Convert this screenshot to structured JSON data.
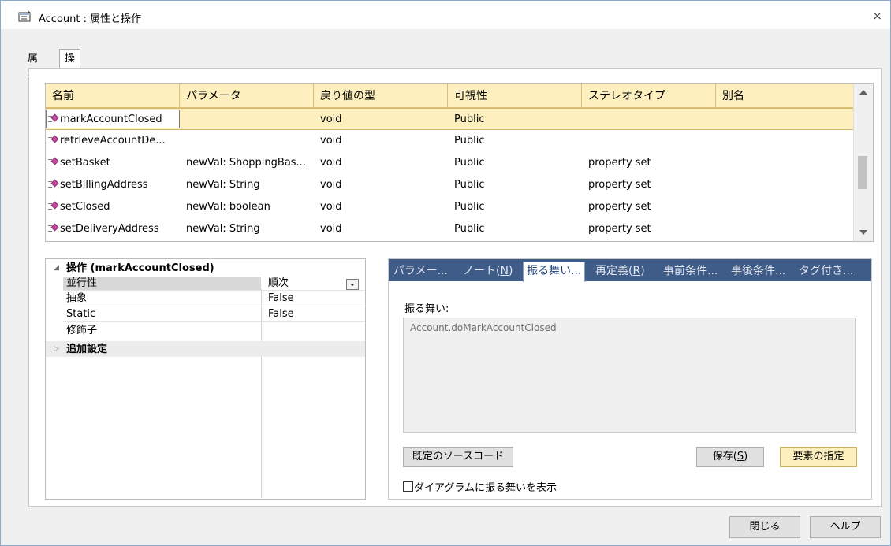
{
  "window": {
    "title": "Account : 属性と操作",
    "close_glyph": "×"
  },
  "tabs": [
    {
      "label": "属性",
      "active": false
    },
    {
      "label": "操作",
      "active": true
    }
  ],
  "grid": {
    "columns": [
      "名前",
      "パラメータ",
      "戻り値の型",
      "可視性",
      "ステレオタイプ",
      "別名"
    ],
    "rows": [
      {
        "name": "markAccountClosed",
        "params": "",
        "return_type": "void",
        "visibility": "Public",
        "stereotype": "",
        "alias": "",
        "selected": true
      },
      {
        "name": "retrieveAccountDe...",
        "params": "",
        "return_type": "void",
        "visibility": "Public",
        "stereotype": "",
        "alias": ""
      },
      {
        "name": "setBasket",
        "params": "newVal: ShoppingBas...",
        "return_type": "void",
        "visibility": "Public",
        "stereotype": "property set",
        "alias": ""
      },
      {
        "name": "setBillingAddress",
        "params": "newVal: String",
        "return_type": "void",
        "visibility": "Public",
        "stereotype": "property set",
        "alias": ""
      },
      {
        "name": "setClosed",
        "params": "newVal: boolean",
        "return_type": "void",
        "visibility": "Public",
        "stereotype": "property set",
        "alias": ""
      },
      {
        "name": "setDeliveryAddress",
        "params": "newVal: String",
        "return_type": "void",
        "visibility": "Public",
        "stereotype": "property set",
        "alias": ""
      }
    ]
  },
  "properties": {
    "section_title": "操作 (markAccountClosed)",
    "expand_glyph": "◢",
    "collapse_glyph": "▷",
    "items": [
      {
        "label": "並行性",
        "value": "順次"
      },
      {
        "label": "抽象",
        "value": "False"
      },
      {
        "label": "Static",
        "value": "False"
      },
      {
        "label": "修飾子",
        "value": ""
      }
    ],
    "advanced_title": "追加設定"
  },
  "detail": {
    "tabs": [
      {
        "label": "パラメー..."
      },
      {
        "label": "ノート(",
        "mnemonic": "N",
        "suffix": ")"
      },
      {
        "label": "振る舞い...",
        "active": true
      },
      {
        "label": "再定義(",
        "mnemonic": "R",
        "suffix": ")"
      },
      {
        "label": "事前条件..."
      },
      {
        "label": "事後条件..."
      },
      {
        "label": "タグ付き..."
      }
    ],
    "behavior_label": "振る舞い:",
    "behavior_text": "Account.doMarkAccountClosed",
    "default_source_button": "既定のソースコード",
    "save_button": {
      "label": "保存(",
      "mnemonic": "S",
      "suffix": ")"
    },
    "assign_element_button": "要素の指定",
    "show_in_diagram_checkbox": "ダイアグラムに振る舞いを表示",
    "show_in_diagram_checked": false
  },
  "footer": {
    "close_button": "閉じる",
    "help_button": "ヘルプ"
  },
  "colors": {
    "header_bg": "#fdf0be",
    "tab_strip_bg": "#3f5b88",
    "operation_icon": "#c24aa0"
  }
}
